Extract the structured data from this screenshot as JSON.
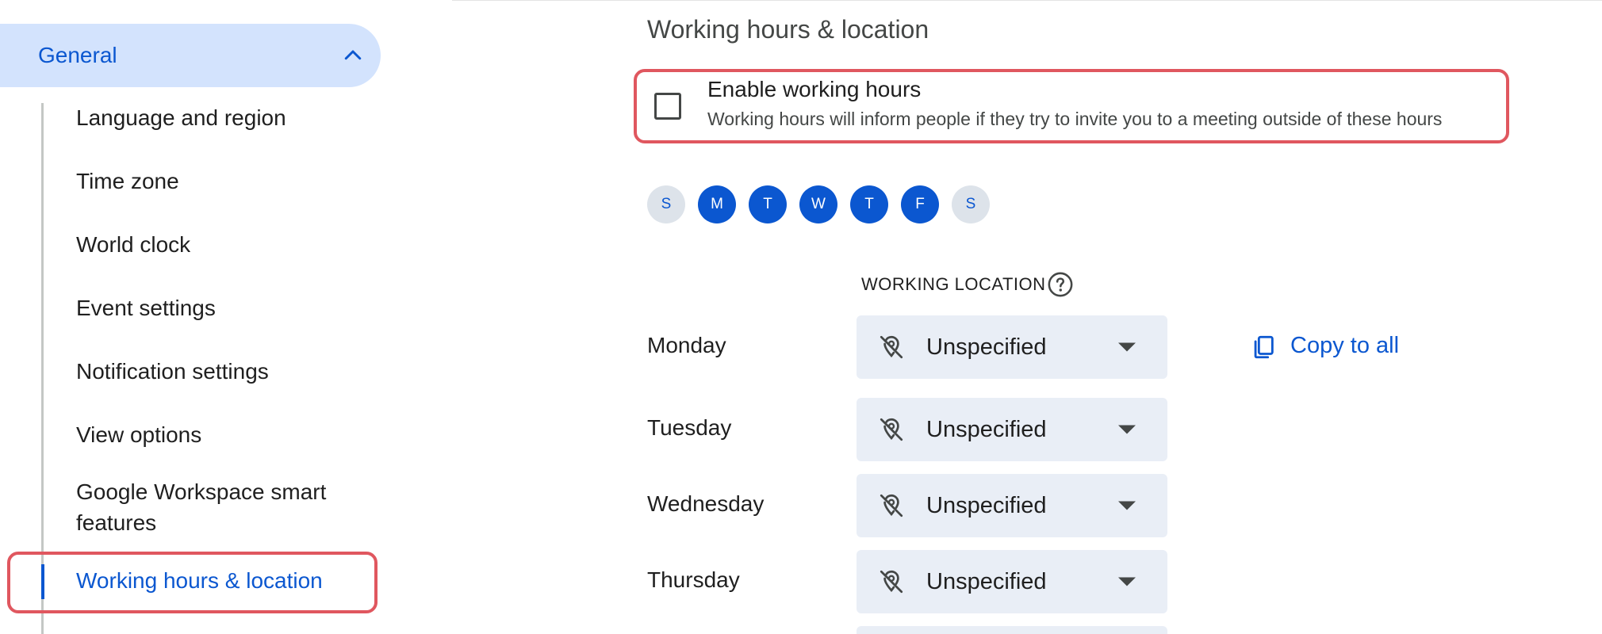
{
  "sidebar": {
    "section": {
      "label": "General"
    },
    "items": [
      {
        "label": "Language and region"
      },
      {
        "label": "Time zone"
      },
      {
        "label": "World clock"
      },
      {
        "label": "Event settings"
      },
      {
        "label": "Notification settings"
      },
      {
        "label": "View options"
      },
      {
        "label": "Google Workspace smart features"
      },
      {
        "label": "Working hours & location",
        "selected": true
      }
    ]
  },
  "main": {
    "title": "Working hours & location",
    "enable": {
      "checked": false,
      "title": "Enable working hours",
      "description": "Working hours will inform people if they try to invite you to a meeting outside of these hours"
    },
    "weekdays": [
      {
        "letter": "S",
        "selected": false
      },
      {
        "letter": "M",
        "selected": true
      },
      {
        "letter": "T",
        "selected": true
      },
      {
        "letter": "W",
        "selected": true
      },
      {
        "letter": "T",
        "selected": true
      },
      {
        "letter": "F",
        "selected": true
      },
      {
        "letter": "S",
        "selected": false
      }
    ],
    "working_location_label": "WORKING LOCATION",
    "days": [
      {
        "name": "Monday",
        "location": "Unspecified"
      },
      {
        "name": "Tuesday",
        "location": "Unspecified"
      },
      {
        "name": "Wednesday",
        "location": "Unspecified"
      },
      {
        "name": "Thursday",
        "location": "Unspecified"
      }
    ],
    "copy_to_all": "Copy to all"
  },
  "icons": {
    "section_toggle": "chevron-up-icon",
    "help": "help-circle-icon",
    "location": "location-off-icon",
    "dropdown": "arrow-drop-down-icon",
    "copy": "copy-icon"
  },
  "colors": {
    "accent": "#0b57d0",
    "pill_background": "#d3e3fd",
    "dropdown_background": "#e9eef6",
    "unselected_day": "#dde3ea",
    "highlight_box": "#e0575f"
  }
}
